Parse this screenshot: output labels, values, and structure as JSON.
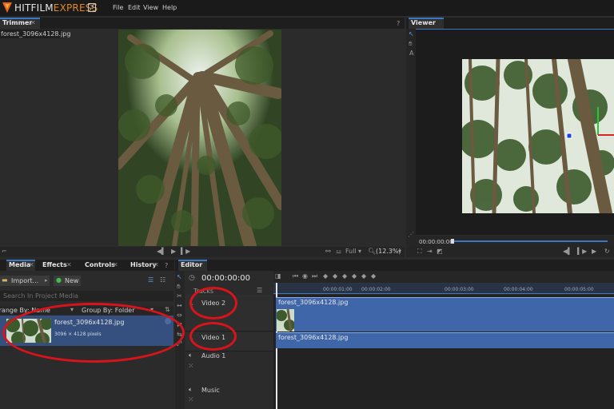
{
  "app": {
    "logo_part1": "HITFILM",
    "logo_part2": "EXPRESS",
    "logo_badge": "3",
    "menu": [
      "File",
      "Edit",
      "View",
      "Help"
    ]
  },
  "trimmer": {
    "tab_label": "Trimmer",
    "file_label": "forest_3096x4128.jpg",
    "quality": "Full",
    "zoom": "(12.3%)"
  },
  "viewer": {
    "tab_label": "Viewer",
    "timecode": "00:00:00:00"
  },
  "media_panel": {
    "tabs": [
      "Media",
      "Effects",
      "Controls",
      "History"
    ],
    "import_label": "Import...",
    "new_label": "New",
    "search_placeholder": "Search In Project Media",
    "arrange_label": "Arrange By: Name",
    "group_label": "Group By: Folder",
    "item": {
      "name": "forest_3096x4128.jpg",
      "size": "3096 × 4128 pixels"
    }
  },
  "editor": {
    "tab_label": "Editor",
    "timecode": "00:00:00:00",
    "tracks_label": "Tracks",
    "ruler": [
      "00:00:01:00",
      "00:00:02:00",
      "00:00:03:00",
      "00:00:04:00",
      "00:00:05:00"
    ],
    "tracks": {
      "video2": "Video 2",
      "video1": "Video 1",
      "audio1": "Audio 1",
      "music": "Music"
    },
    "clips": {
      "video2_clip": "forest_3096x4128.jpg",
      "video1_clip": "forest_3096x4128.jpg"
    }
  },
  "colors": {
    "accent_blue": "#3b78c4",
    "clip_blue": "#3f66a8",
    "annotation_red": "#d8141a",
    "logo_orange": "#e08a2a"
  }
}
